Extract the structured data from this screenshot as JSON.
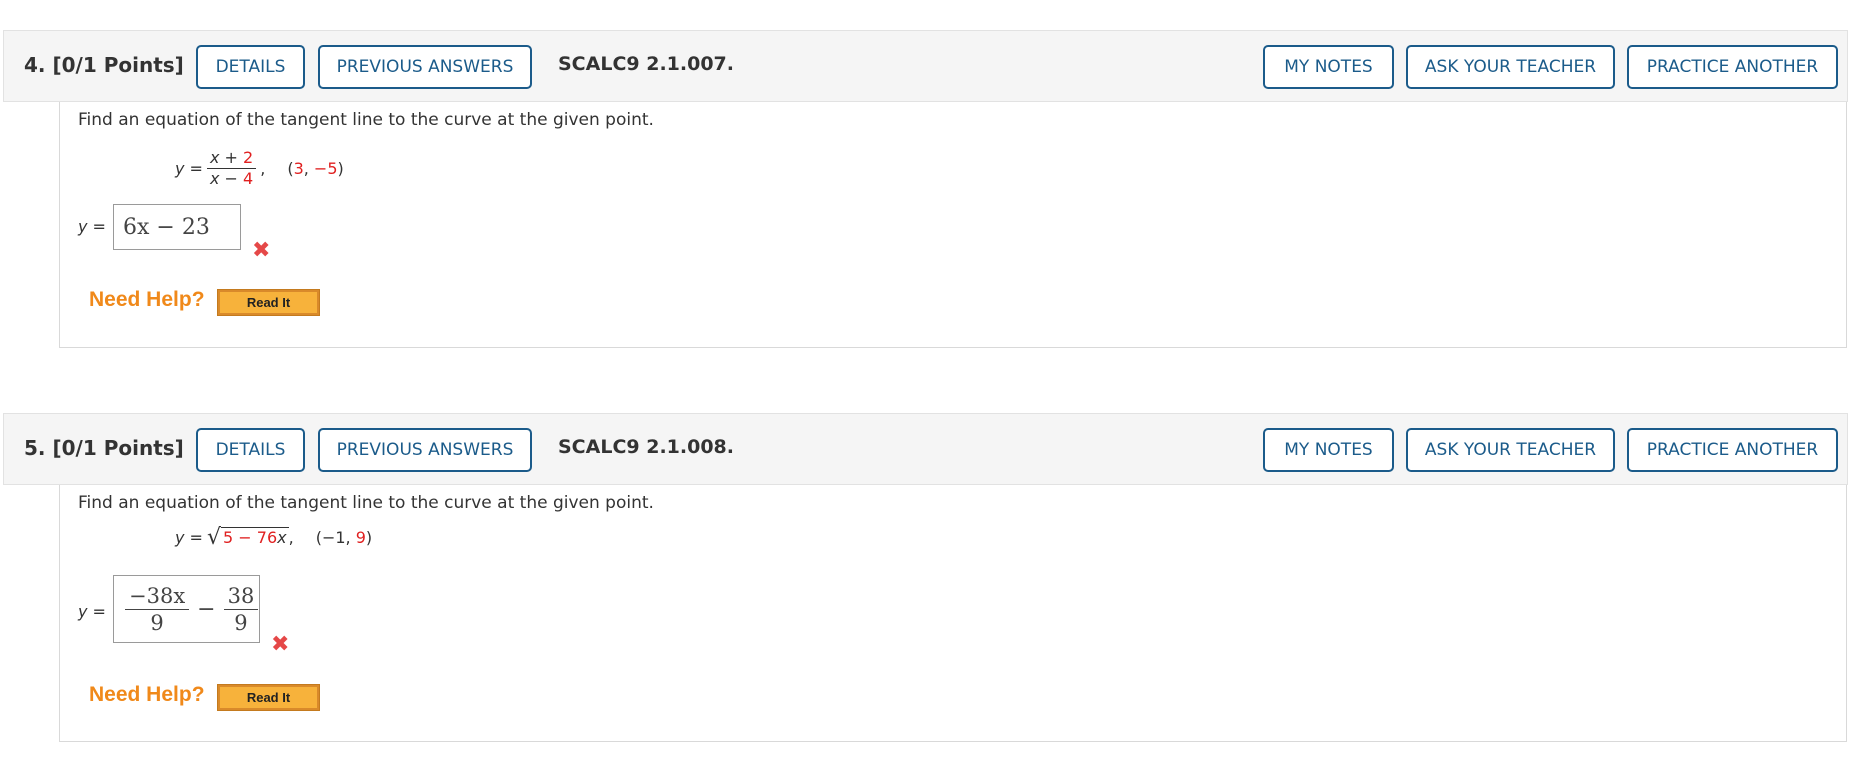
{
  "questions": [
    {
      "number": "4.",
      "points": "[0/1 Points]",
      "buttons": {
        "details": "DETAILS",
        "previous_answers": "PREVIOUS ANSWERS",
        "my_notes": "MY NOTES",
        "ask_teacher": "ASK YOUR TEACHER",
        "practice_another": "PRACTICE ANOTHER"
      },
      "code": "SCALC9 2.1.007.",
      "prompt": "Find an equation of the tangent line to the curve at the given point.",
      "equation": {
        "lhs": "y =",
        "num_var": "x +",
        "num_const": "2",
        "den_var": "x −",
        "den_const": "4",
        "comma": ",",
        "point_open": "(",
        "point_x": "3",
        "point_sep": ", ",
        "point_y": "−5",
        "point_close": ")"
      },
      "answer_label": "y =",
      "answer": "6x − 23",
      "status_icon": "wrong-x-icon",
      "need_help": "Need Help?",
      "read_it": "Read It"
    },
    {
      "number": "5.",
      "points": "[0/1 Points]",
      "buttons": {
        "details": "DETAILS",
        "previous_answers": "PREVIOUS ANSWERS",
        "my_notes": "MY NOTES",
        "ask_teacher": "ASK YOUR TEACHER",
        "practice_another": "PRACTICE ANOTHER"
      },
      "code": "SCALC9 2.1.008.",
      "prompt": "Find an equation of the tangent line to the curve at the given point.",
      "equation": {
        "lhs": "y =",
        "radical": "√",
        "radicand_const": "5 − 76",
        "radicand_var": "x",
        "comma": ",",
        "point_open": "(",
        "point_x": "−1",
        "point_sep": ", ",
        "point_y": "9",
        "point_close": ")"
      },
      "answer_label": "y =",
      "answer": {
        "frac1_num": "−38x",
        "frac1_den": "9",
        "minus": "−",
        "frac2_num": "38",
        "frac2_den": "9"
      },
      "status_icon": "wrong-x-icon",
      "need_help": "Need Help?",
      "read_it": "Read It"
    }
  ],
  "colors": {
    "button_border": "#1b5b8a",
    "wrong": "#e54848",
    "help": "#f0891a",
    "highlight_red": "#e02020"
  }
}
